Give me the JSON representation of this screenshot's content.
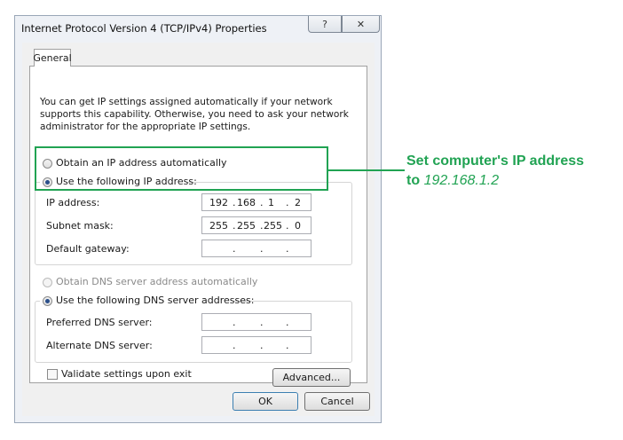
{
  "window": {
    "title": "Internet Protocol Version 4 (TCP/IPv4) Properties",
    "help_label": "?",
    "close_label": "✕"
  },
  "tabs": [
    {
      "label": "General"
    }
  ],
  "description": "You can get IP settings assigned automatically if your network supports this capability. Otherwise, you need to ask your network administrator for the appropriate IP settings.",
  "ip": {
    "auto_label": "Obtain an IP address automatically",
    "manual_label": "Use the following IP address:",
    "selected": "manual",
    "address_label": "IP address:",
    "address_value": [
      "192",
      "168",
      "1",
      "2"
    ],
    "subnet_label": "Subnet mask:",
    "subnet_value": [
      "255",
      "255",
      "255",
      "0"
    ],
    "gateway_label": "Default gateway:",
    "gateway_value": [
      "",
      "",
      "",
      ""
    ]
  },
  "dns": {
    "auto_label": "Obtain DNS server address automatically",
    "manual_label": "Use the following DNS server addresses:",
    "selected": "manual",
    "preferred_label": "Preferred DNS server:",
    "preferred_value": [
      "",
      "",
      "",
      ""
    ],
    "alternate_label": "Alternate DNS server:",
    "alternate_value": [
      "",
      "",
      "",
      ""
    ]
  },
  "validate_label": "Validate settings upon exit",
  "validate_checked": false,
  "buttons": {
    "advanced": "Advanced...",
    "ok": "OK",
    "cancel": "Cancel"
  },
  "annotation": {
    "line1": "Set computer's IP address",
    "line2_prefix": "to",
    "line2_value": "192.168.1.2"
  },
  "colors": {
    "accent_green": "#21a353",
    "radio_dot": "#2a4f8a"
  }
}
